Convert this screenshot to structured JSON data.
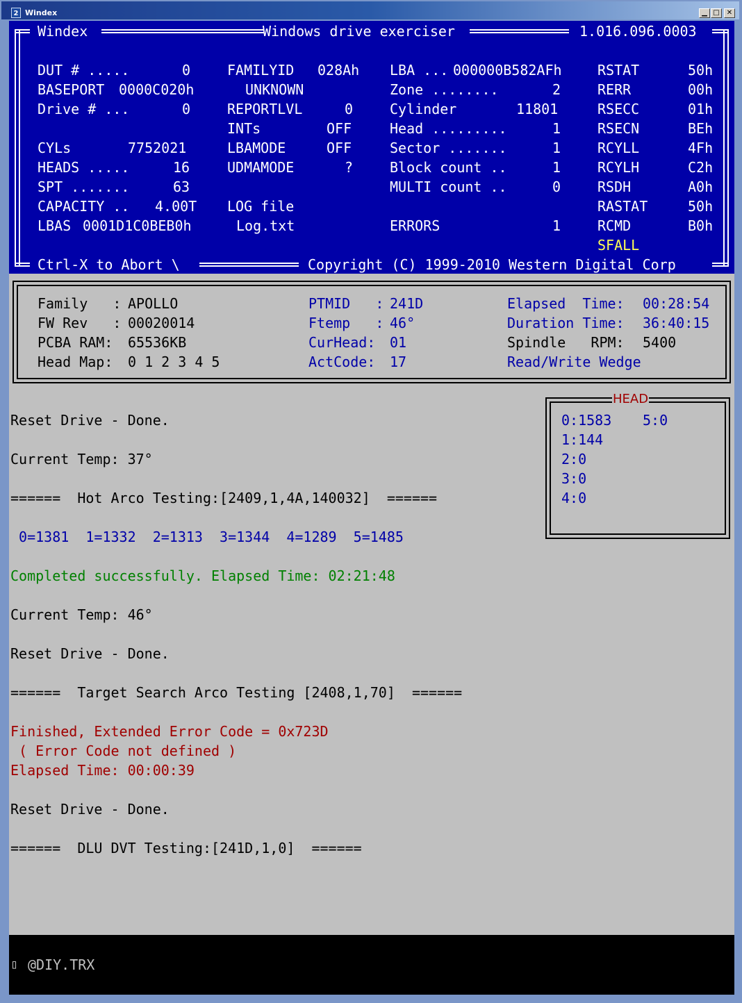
{
  "window": {
    "title": "Windex",
    "icon_label": "2",
    "buttons": [
      "minimize-icon",
      "maximize-icon",
      "close-icon"
    ]
  },
  "header": {
    "app_name": "Windex",
    "app_desc": "Windows drive exerciser",
    "version": "1.016.096.0003",
    "abort_hint": "Ctrl-X to Abort \\",
    "copyright": "Copyright (C) 1999-2010 Western Digital Corp",
    "col1": {
      "dut_label": "DUT # .....",
      "dut_value": "0",
      "baseport_label": "BASEPORT",
      "baseport_value": "0000C020h",
      "drive_label": "Drive # ...",
      "drive_value": "0",
      "cyls_label": "CYLs",
      "cyls_value": "7752021",
      "heads_label": "HEADS .....",
      "heads_value": "16",
      "spt_label": "SPT .......",
      "spt_value": "63",
      "capacity_label": "CAPACITY ..",
      "capacity_value": "4.00T",
      "lbas_label": "LBAS",
      "lbas_value": "0001D1C0BEB0h"
    },
    "col2": {
      "familyid_label": "FAMILYID",
      "familyid_value": "028Ah",
      "family_name": "UNKNOWN",
      "reportlvl_label": "REPORTLVL",
      "reportlvl_value": "0",
      "ints_label": "INTs",
      "ints_value": "OFF",
      "lbamode_label": "LBAMODE",
      "lbamode_value": "OFF",
      "udmamode_label": "UDMAMODE",
      "udmamode_value": "?",
      "logfile_label": "LOG file",
      "logfile_value": "Log.txt"
    },
    "col3": {
      "lba_label": "LBA ...",
      "lba_value": "000000B582AFh",
      "zone_label": "Zone ........",
      "zone_value": "2",
      "cylinder_label": "Cylinder",
      "cylinder_value": "11801",
      "head_label": "Head .........",
      "head_value": "1",
      "sector_label": "Sector .......",
      "sector_value": "1",
      "block_label": "Block count ..",
      "block_value": "1",
      "multi_label": "MULTI count ..",
      "multi_value": "0",
      "errors_label": "ERRORS",
      "errors_value": "1"
    },
    "col4": [
      {
        "label": "RSTAT",
        "value": "50h"
      },
      {
        "label": "RERR",
        "value": "00h"
      },
      {
        "label": "RSECC",
        "value": "01h"
      },
      {
        "label": "RSECN",
        "value": "BEh"
      },
      {
        "label": "RCYLL",
        "value": "4Fh"
      },
      {
        "label": "RCYLH",
        "value": "C2h"
      },
      {
        "label": "RSDH",
        "value": "A0h"
      },
      {
        "label": "RASTAT",
        "value": "50h"
      },
      {
        "label": "RCMD",
        "value": "B0h"
      }
    ],
    "sfall": "SFALL",
    "sfall_color": "#ffff55"
  },
  "info": {
    "family_label": "Family   :",
    "family_value": "APOLLO",
    "fwrev_label": "FW Rev   :",
    "fwrev_value": "00020014",
    "pcba_label": "PCBA RAM:",
    "pcba_value": "65536KB",
    "headmap_label": "Head Map:",
    "headmap_value": "0 1 2 3 4 5",
    "ptmid_label": "PTMID   :",
    "ptmid_value": "241D",
    "ftemp_label": "Ftemp   :",
    "ftemp_value": "46°",
    "curhead_label": "CurHead:",
    "curhead_value": "01",
    "actcode_label": "ActCode:",
    "actcode_value": "17",
    "elapsed_label": "Elapsed  Time:",
    "elapsed_value": "00:28:54",
    "duration_label": "Duration Time:",
    "duration_value": "36:40:15",
    "spindle_label": "Spindle   RPM:",
    "spindle_value": "5400",
    "wedge_label": "Read/Write Wedge"
  },
  "head_panel": {
    "title": "HEAD",
    "entries": [
      "0:1583",
      "5:0",
      "1:144",
      "2:0",
      "3:0",
      "4:0"
    ]
  },
  "log": [
    {
      "text": "Reset Drive - Done.",
      "color": "#000000"
    },
    {
      "text": "Current Temp: 37°",
      "color": "#000000"
    },
    {
      "text": "======  Hot Arco Testing:[2409,1,4A,140032]  ======",
      "color": "#000000"
    },
    {
      "text": " 0=1381  1=1332  2=1313  3=1344  4=1289  5=1485",
      "color": "#0000a8"
    },
    {
      "text": "Completed successfully. Elapsed Time: 02:21:48",
      "color": "#008000"
    },
    {
      "text": "Current Temp: 46°",
      "color": "#000000"
    },
    {
      "text": "Reset Drive - Done.",
      "color": "#000000"
    },
    {
      "text": "======  Target Search Arco Testing [2408,1,70]  ======",
      "color": "#000000"
    },
    {
      "text": "Finished, Extended Error Code = 0x723D",
      "color": "#a00000"
    },
    {
      "text": " ( Error Code not defined )",
      "color": "#a00000"
    },
    {
      "text": "Elapsed Time: 00:00:39",
      "color": "#a00000"
    },
    {
      "text": "Reset Drive - Done.",
      "color": "#000000"
    },
    {
      "text": "======  DLU DVT Testing:[241D,1,0]  ======",
      "color": "#000000"
    }
  ],
  "footer": {
    "prompt_glyph": "▯",
    "prompt_text": "@DIY.TRX"
  }
}
